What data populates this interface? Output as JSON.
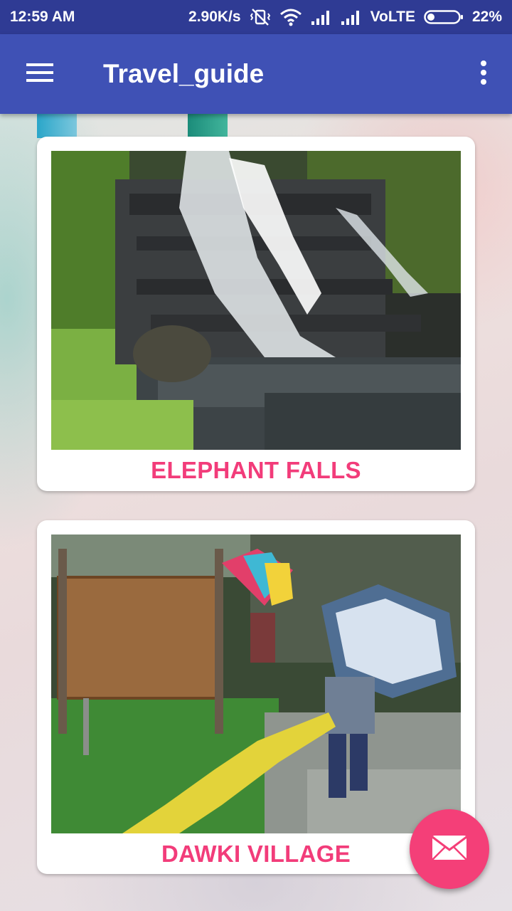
{
  "status_bar": {
    "time": "12:59 AM",
    "network_speed": "2.90K/s",
    "network_type": "VoLTE",
    "battery_percent": "22%",
    "battery_level": 0.22,
    "icons": [
      "vibrate-off-icon",
      "wifi-icon",
      "signal-icon",
      "signal-icon",
      "battery-icon"
    ]
  },
  "app_bar": {
    "title": "Travel_guide",
    "menu_icon": "hamburger-menu-icon",
    "overflow_icon": "more-vert-icon",
    "color": "#3f51b5"
  },
  "cards": [
    {
      "title": "ELEPHANT FALLS",
      "image": "waterfall-photo"
    },
    {
      "title": "DAWKI VILLAGE",
      "image": "village-photo"
    }
  ],
  "fab": {
    "icon": "mail-icon",
    "color": "#f43f78"
  },
  "colors": {
    "status_bar": "#2f3b94",
    "title_accent": "#f23c7a"
  }
}
